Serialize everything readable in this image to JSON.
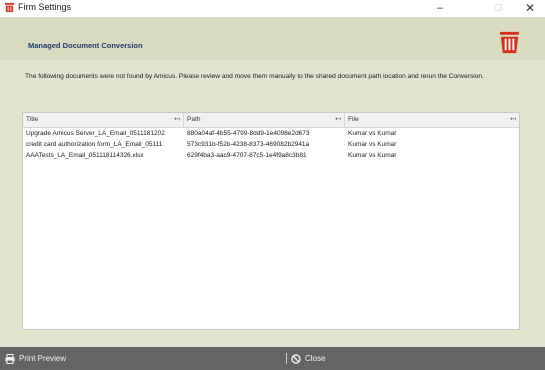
{
  "window": {
    "title": "Firm Settings",
    "min_glyph": "–",
    "max_glyph": "□",
    "close_glyph": "✕"
  },
  "header": {
    "title": "Managed Document Conversion"
  },
  "message": "The following documents were not found by Amicus. Please review and move them manually to the shared document path location and rerun the Conversion.",
  "grid": {
    "columns": [
      {
        "label": "Title"
      },
      {
        "label": "Path"
      },
      {
        "label": "File"
      }
    ],
    "pin_glyph": "↤",
    "rows": [
      {
        "title": "Upgrade Amicus Server_LA_Email_0511181202",
        "path": "880a04af-4b55-4799-8dd9-1e4098e2d673",
        "file": "Kumar vs Kumar"
      },
      {
        "title": "credit card authorization form_LA_Email_05111",
        "path": "573c931b-f52b-4238-8373-469082b2941a",
        "file": "Kumar vs Kumar"
      },
      {
        "title": "AAATests_LA_Email_051118114326.xlsx",
        "path": "629f4ba3-aac9-4707-87c5-1e4f9a8c3b81",
        "file": "Kumar vs Kumar"
      }
    ]
  },
  "footer": {
    "print_label": "Print Preview",
    "close_label": "Close"
  },
  "icons": {
    "app": "amicus-logo-icon",
    "print": "printer-icon",
    "close": "no-entry-icon"
  },
  "colors": {
    "brand_red": "#d6301e",
    "header_text": "#223a6b",
    "panel_bg": "#e3e4cf",
    "footer_bg": "#646464"
  }
}
